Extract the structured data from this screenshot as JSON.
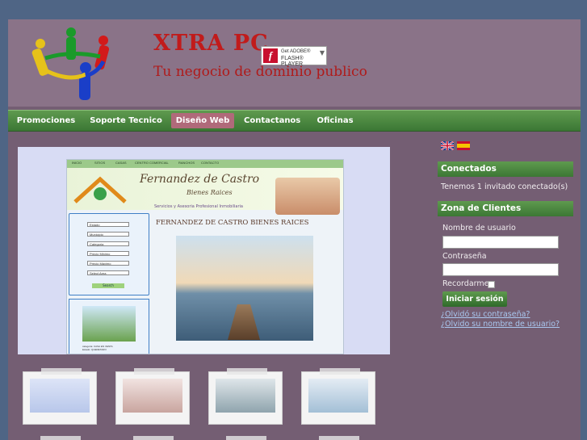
{
  "header": {
    "title": "XTRA PC",
    "slogan": "Tu negocio de dominio publico",
    "flash_badge": {
      "line1": "Get ADOBE®",
      "line2": "FLASH® PLAYER",
      "icon": "flash-icon"
    }
  },
  "nav": {
    "items": [
      {
        "label": "Promociones"
      },
      {
        "label": "Soporte Tecnico"
      },
      {
        "label": "Diseño Web",
        "active": true
      },
      {
        "label": "Contactanos"
      },
      {
        "label": "Oficinas"
      }
    ]
  },
  "slideshow": {
    "preview_tabs": [
      "INICIO",
      "SITIOS",
      "CASAS",
      "CENTRO COMERCIAL",
      "RANCHOS",
      "CONTACTO"
    ],
    "preview_title": "Fernandez de Castro",
    "preview_subtitle": "Bienes Raices",
    "preview_tagline": "Servicios y Asesoria Profesional Inmobiliaria",
    "preview_heading": "FERNANDEZ DE CASTRO BIENES RAICES",
    "preview_fields": [
      "Estado",
      "Municipio",
      "Categoria",
      "Precio Minimo",
      "Precio Maximo",
      "Select Area"
    ],
    "preview_button": "Search",
    "preview_caption_1": "categoria: CASA EN VENTA",
    "preview_caption_2": "Estado: QUERETARO"
  },
  "thumbnails": [
    "thumb-1",
    "thumb-2",
    "thumb-3",
    "thumb-4"
  ],
  "sidebar": {
    "languages": [
      {
        "name": "English",
        "icon": "uk-flag-icon"
      },
      {
        "name": "Español",
        "icon": "spain-flag-icon"
      }
    ],
    "online": {
      "title": "Conectados",
      "text": "Tenemos 1 invitado conectado(s)"
    },
    "login": {
      "title": "Zona de Clientes",
      "username_label": "Nombre de usuario",
      "password_label": "Contraseña",
      "remember_label": "Recordarme",
      "submit_label": "Iniciar sesión",
      "forgot_password": "¿Olvidó su contraseña?",
      "forgot_username": "¿Olvido su nombre de usuario?"
    }
  },
  "colors": {
    "page_bg": "#745e73",
    "header_bg": "#8a7388",
    "nav_green": "#3b7734",
    "title_red": "#c11b1b",
    "active_tab": "#b06a7a"
  }
}
